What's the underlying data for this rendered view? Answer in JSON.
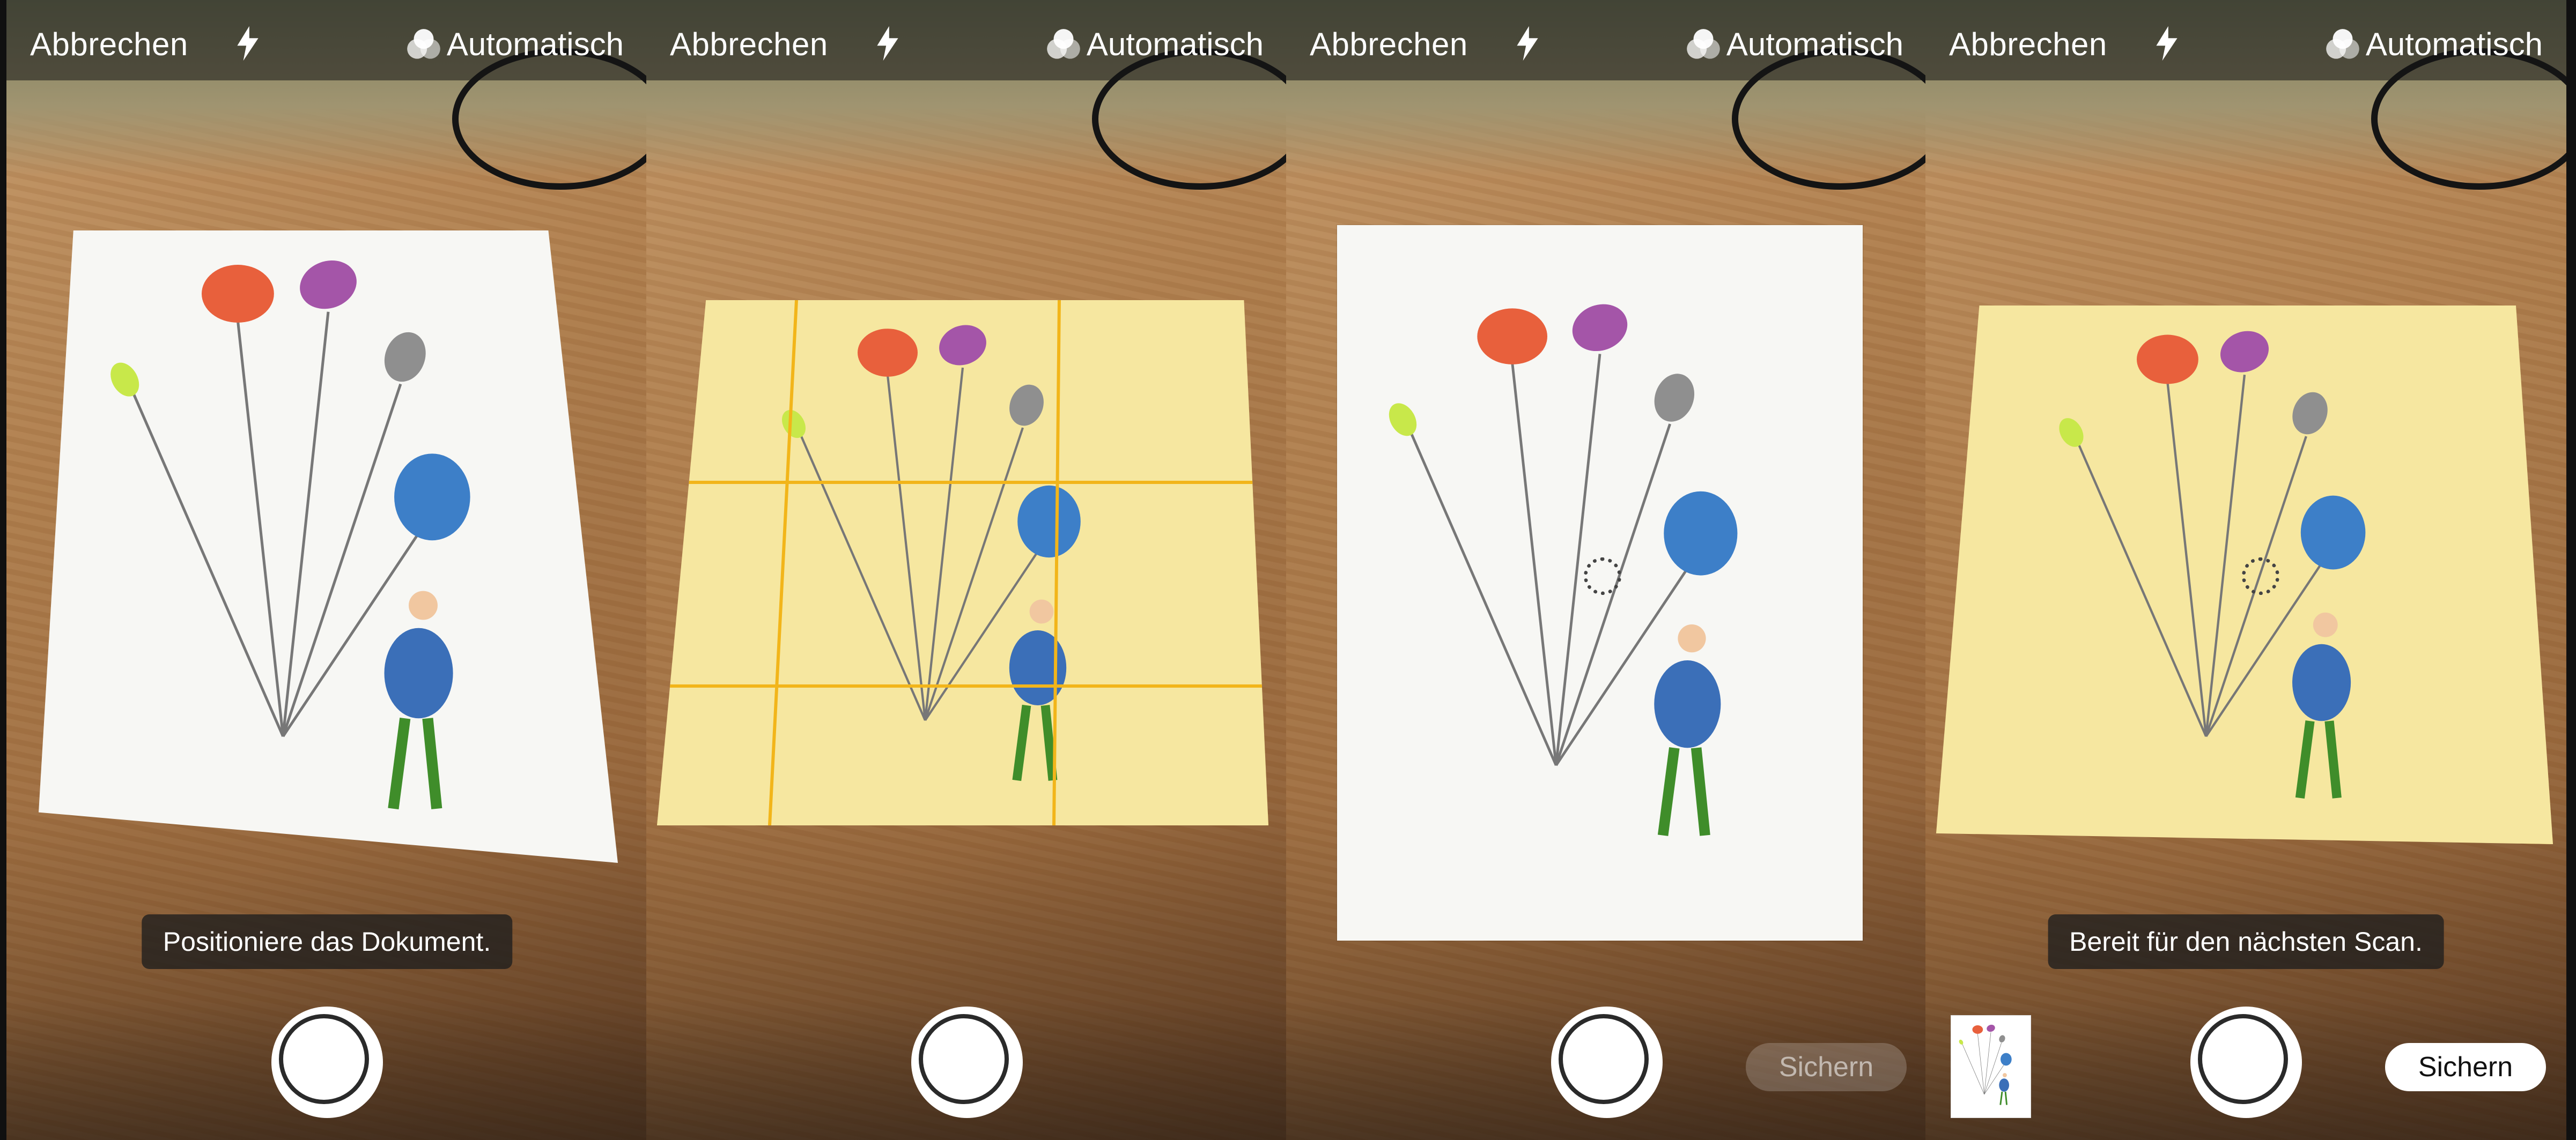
{
  "colors": {
    "accent": "#e6bc20",
    "detected_overlay": "#f6e7a0",
    "topbar_bg": "rgba(20,20,20,0.55)"
  },
  "panels": [
    {
      "topbar": {
        "cancel_label": "Abbrechen",
        "flash_icon": "flash-icon",
        "filter_icon": "color-filter-icon",
        "filter_label": "Automatisch"
      },
      "hint": "Positioniere das Dokument.",
      "shutter_icon": "shutter-button",
      "save_label": ""
    },
    {
      "topbar": {
        "cancel_label": "Abbrechen",
        "flash_icon": "flash-icon",
        "filter_icon": "color-filter-icon",
        "filter_label": "Automatisch"
      },
      "hint": "",
      "shutter_icon": "shutter-button",
      "save_label": ""
    },
    {
      "topbar": {
        "cancel_label": "Abbrechen",
        "flash_icon": "flash-icon",
        "filter_icon": "color-filter-icon",
        "filter_label": "Automatisch"
      },
      "hint": "",
      "shutter_icon": "shutter-button",
      "save_label": "Sichern",
      "save_state": "disabled"
    },
    {
      "topbar": {
        "cancel_label": "Abbrechen",
        "flash_icon": "flash-icon",
        "filter_icon": "color-filter-icon",
        "filter_label": "Automatisch"
      },
      "hint": "Bereit für den nächsten Scan.",
      "shutter_icon": "shutter-button",
      "save_label": "Sichern",
      "save_state": "enabled",
      "thumbnail": "scanned-page-thumbnail"
    }
  ]
}
